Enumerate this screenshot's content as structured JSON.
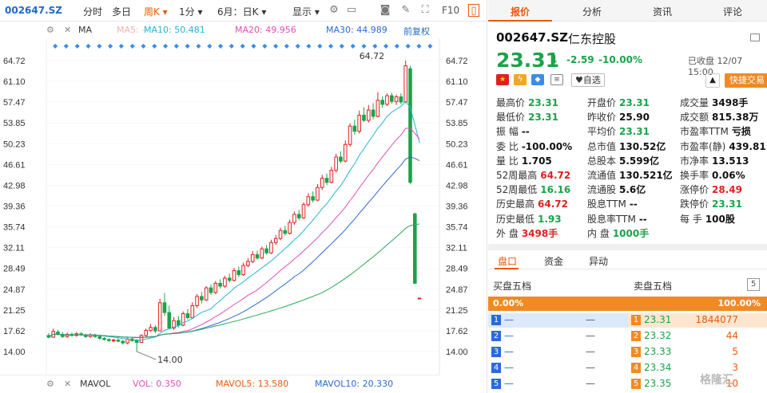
{
  "toolbar": {
    "code": "002647.SZ",
    "items": [
      "分时",
      "多日",
      "周K ▾",
      "1分 ▾",
      "6月：日K ▾",
      "显示 ▾"
    ],
    "f10": "F10"
  },
  "ma": {
    "label": "MA",
    "ma5": "MA5: --",
    "ma10": "MA10: 50.481",
    "ma20": "MA20: 49.956",
    "ma30": "MA30: 44.989",
    "adjust": "前复权"
  },
  "axis": {
    "left": [
      "64.72",
      "61.10",
      "57.47",
      "53.85",
      "50.23",
      "46.61",
      "42.98",
      "39.36",
      "35.74",
      "32.11",
      "28.49",
      "24.87",
      "21.25",
      "17.62",
      "14.00"
    ],
    "right": [
      "64.72",
      "61.10",
      "57.47",
      "53.85",
      "50.23",
      "46.61",
      "42.98",
      "39.36",
      "35.74",
      "32.11",
      "28.49",
      "24.87",
      "21.25",
      "17.62",
      "14.00"
    ],
    "hi_label": "64.72",
    "lo_label": "14.00"
  },
  "colors": {
    "up": "#e02020",
    "down": "#1aa34a",
    "ma10": "#23b5d3",
    "ma20": "#e04fb5",
    "ma30": "#2a6ad8",
    "ma60": "#27a85a"
  },
  "chart_data": {
    "type": "candlestick",
    "ylim": [
      14.0,
      64.72
    ],
    "candles": [
      [
        16.8,
        16.5,
        17.2,
        16.3
      ],
      [
        16.5,
        17.5,
        18.0,
        16.4
      ],
      [
        17.4,
        17.0,
        17.8,
        16.8
      ],
      [
        17.0,
        16.6,
        17.4,
        16.4
      ],
      [
        16.6,
        17.0,
        17.3,
        16.4
      ],
      [
        17.0,
        16.8,
        17.3,
        16.6
      ],
      [
        16.8,
        17.1,
        17.4,
        16.6
      ],
      [
        17.1,
        16.9,
        17.4,
        16.7
      ],
      [
        16.9,
        16.6,
        17.1,
        16.4
      ],
      [
        16.6,
        16.9,
        17.2,
        16.4
      ],
      [
        16.9,
        16.6,
        17.1,
        16.4
      ],
      [
        16.6,
        16.3,
        16.9,
        16.1
      ],
      [
        16.3,
        16.1,
        16.5,
        15.9
      ],
      [
        16.1,
        15.9,
        16.3,
        15.7
      ],
      [
        15.9,
        16.0,
        16.2,
        15.6
      ],
      [
        16.0,
        15.8,
        16.3,
        15.6
      ],
      [
        15.8,
        15.5,
        16.0,
        15.2
      ],
      [
        15.5,
        16.2,
        16.4,
        15.3
      ],
      [
        16.2,
        15.9,
        16.5,
        15.7
      ],
      [
        15.9,
        15.6,
        16.2,
        14.0
      ],
      [
        15.6,
        16.8,
        17.0,
        15.5
      ],
      [
        16.8,
        17.7,
        18.0,
        16.6
      ],
      [
        17.7,
        18.2,
        18.8,
        17.4
      ],
      [
        18.2,
        17.6,
        18.6,
        17.2
      ],
      [
        17.6,
        22.5,
        23.2,
        17.5
      ],
      [
        22.5,
        20.8,
        24.2,
        20.2
      ],
      [
        20.8,
        18.1,
        22.0,
        17.9
      ],
      [
        18.1,
        19.4,
        20.0,
        17.8
      ],
      [
        19.4,
        18.6,
        20.2,
        18.2
      ],
      [
        18.6,
        20.6,
        21.0,
        18.4
      ],
      [
        20.6,
        19.9,
        21.4,
        19.6
      ],
      [
        19.9,
        22.0,
        22.6,
        19.7
      ],
      [
        22.0,
        23.6,
        24.0,
        21.6
      ],
      [
        23.6,
        23.0,
        24.4,
        22.4
      ],
      [
        23.0,
        25.1,
        25.4,
        22.8
      ],
      [
        25.1,
        24.3,
        25.7,
        23.9
      ],
      [
        24.3,
        25.9,
        26.3,
        24.0
      ],
      [
        25.9,
        25.4,
        26.6,
        25.0
      ],
      [
        25.4,
        26.8,
        27.2,
        25.1
      ],
      [
        26.8,
        26.4,
        27.6,
        26.0
      ],
      [
        26.4,
        28.1,
        28.6,
        26.2
      ],
      [
        28.1,
        27.4,
        28.8,
        27.0
      ],
      [
        27.4,
        29.0,
        29.5,
        27.2
      ],
      [
        29.0,
        29.7,
        30.3,
        28.7
      ],
      [
        29.7,
        30.9,
        31.5,
        29.4
      ],
      [
        30.9,
        30.3,
        31.6,
        30.0
      ],
      [
        30.3,
        31.9,
        32.3,
        30.1
      ],
      [
        31.9,
        31.2,
        32.6,
        30.9
      ],
      [
        31.2,
        33.0,
        33.5,
        31.0
      ],
      [
        33.0,
        33.7,
        34.3,
        32.6
      ],
      [
        33.7,
        35.1,
        35.6,
        33.4
      ],
      [
        35.1,
        34.6,
        35.9,
        34.2
      ],
      [
        34.6,
        36.5,
        37.0,
        34.4
      ],
      [
        36.5,
        37.9,
        38.4,
        36.1
      ],
      [
        37.9,
        37.3,
        38.7,
        36.9
      ],
      [
        37.3,
        39.6,
        40.0,
        37.1
      ],
      [
        39.6,
        41.0,
        41.6,
        39.2
      ],
      [
        41.0,
        40.4,
        41.9,
        40.0
      ],
      [
        40.4,
        42.6,
        43.2,
        40.2
      ],
      [
        42.6,
        44.2,
        44.8,
        42.2
      ],
      [
        44.2,
        43.5,
        45.0,
        43.0
      ],
      [
        43.5,
        45.6,
        46.2,
        43.3
      ],
      [
        45.6,
        47.9,
        48.5,
        45.2
      ],
      [
        47.9,
        47.2,
        48.9,
        46.8
      ],
      [
        47.2,
        50.1,
        50.8,
        47.0
      ],
      [
        50.1,
        53.3,
        53.8,
        49.7
      ],
      [
        53.3,
        52.4,
        54.4,
        51.8
      ],
      [
        52.4,
        55.2,
        56.0,
        52.0
      ],
      [
        55.2,
        54.3,
        56.6,
        54.0
      ],
      [
        54.3,
        56.1,
        57.0,
        53.9
      ],
      [
        56.1,
        55.0,
        57.3,
        54.5
      ],
      [
        55.0,
        57.8,
        59.2,
        54.8
      ],
      [
        57.8,
        57.1,
        58.5,
        56.5
      ],
      [
        57.1,
        58.6,
        59.0,
        56.8
      ],
      [
        58.6,
        57.6,
        59.1,
        57.2
      ],
      [
        57.6,
        58.4,
        58.8,
        57.0
      ],
      [
        58.4,
        57.5,
        59.0,
        57.1
      ],
      [
        57.5,
        63.8,
        64.72,
        57.3
      ],
      [
        63.3,
        43.5,
        63.8,
        43.2
      ],
      [
        38.0,
        25.9,
        38.2,
        25.8
      ],
      [
        23.31,
        23.31,
        23.31,
        23.31
      ]
    ],
    "ma_lines": [
      "MA10",
      "MA20",
      "MA30",
      "MA60"
    ]
  },
  "vol": {
    "label": "MAVOL",
    "vol": "VOL: 0.350",
    "mavol5": "MAVOL5: 13.580",
    "mavol10": "MAVOL10: 20.330"
  },
  "tabs": [
    "报价",
    "分析",
    "资讯",
    "评论"
  ],
  "quote": {
    "code": "002647.SZ",
    "name": "仁东控股",
    "price": "23.31",
    "arrow": "⬇",
    "change": "-2.59",
    "pct": "-10.00%",
    "closed": "已收盘 12/07 15:00",
    "auto": "♥自选",
    "trade": "快捷交易"
  },
  "stats": [
    [
      {
        "l": "最高价",
        "v": "23.31",
        "c": "g"
      },
      {
        "l": "开盘价",
        "v": "23.31",
        "c": "g"
      },
      {
        "l": "成交量",
        "v": "3498手",
        "c": "k"
      }
    ],
    [
      {
        "l": "最低价",
        "v": "23.31",
        "c": "g"
      },
      {
        "l": "昨收价",
        "v": "25.90",
        "c": "k"
      },
      {
        "l": "成交额",
        "v": "815.38万",
        "c": "k"
      }
    ],
    [
      {
        "l": "振    幅",
        "v": "--",
        "c": "k"
      },
      {
        "l": "平均价",
        "v": "23.31",
        "c": "g"
      },
      {
        "l": "市盈率TTM",
        "v": "亏损",
        "c": "k"
      }
    ],
    [
      {
        "l": "委    比",
        "v": "-100.00%",
        "c": "k"
      },
      {
        "l": "总市值",
        "v": "130.52亿",
        "c": "k"
      },
      {
        "l": "市盈率(静)",
        "v": "439.811",
        "c": "k"
      }
    ],
    [
      {
        "l": "量    比",
        "v": "1.705",
        "c": "k"
      },
      {
        "l": "总股本",
        "v": "5.599亿",
        "c": "k"
      },
      {
        "l": "市净率",
        "v": "13.513",
        "c": "k"
      }
    ],
    [
      {
        "l": "52周最高",
        "v": "64.72",
        "c": "r"
      },
      {
        "l": "流通值",
        "v": "130.521亿",
        "c": "k"
      },
      {
        "l": "换手率",
        "v": "0.06%",
        "c": "k"
      }
    ],
    [
      {
        "l": "52周最低",
        "v": "16.16",
        "c": "g"
      },
      {
        "l": "流通股",
        "v": "5.6亿",
        "c": "k"
      },
      {
        "l": "涨停价",
        "v": "28.49",
        "c": "r"
      }
    ],
    [
      {
        "l": "历史最高",
        "v": "64.72",
        "c": "r"
      },
      {
        "l": "股息TTM",
        "v": "--",
        "c": "k"
      },
      {
        "l": "跌停价",
        "v": "23.31",
        "c": "g"
      }
    ],
    [
      {
        "l": "历史最低",
        "v": "1.93",
        "c": "g"
      },
      {
        "l": "股息率TTM",
        "v": "--",
        "c": "k"
      },
      {
        "l": "每    手",
        "v": "100股",
        "c": "k"
      }
    ],
    [
      {
        "l": "外    盘",
        "v": "3498手",
        "c": "r"
      },
      {
        "l": "内    盘",
        "v": "1000手",
        "c": "g"
      }
    ]
  ],
  "subtabs": [
    "盘口",
    "资金",
    "异动"
  ],
  "orderbook": {
    "buy_title": "买盘五档",
    "sell_title": "卖盘五档",
    "buy_pct": "0.00%",
    "sell_pct": "100.00%",
    "buys": [
      {
        "n": "1",
        "p": "—",
        "v": "—"
      },
      {
        "n": "2",
        "p": "—",
        "v": "—"
      },
      {
        "n": "3",
        "p": "—",
        "v": "—"
      },
      {
        "n": "4",
        "p": "—",
        "v": "—"
      },
      {
        "n": "5",
        "p": "—",
        "v": "—"
      }
    ],
    "sells": [
      {
        "n": "1",
        "p": "23.31",
        "v": "1844077"
      },
      {
        "n": "2",
        "p": "23.32",
        "v": "44"
      },
      {
        "n": "3",
        "p": "23.33",
        "v": "5"
      },
      {
        "n": "4",
        "p": "23.34",
        "v": "3"
      },
      {
        "n": "5",
        "p": "23.35",
        "v": "10"
      }
    ]
  },
  "watermark": "格隆汇"
}
